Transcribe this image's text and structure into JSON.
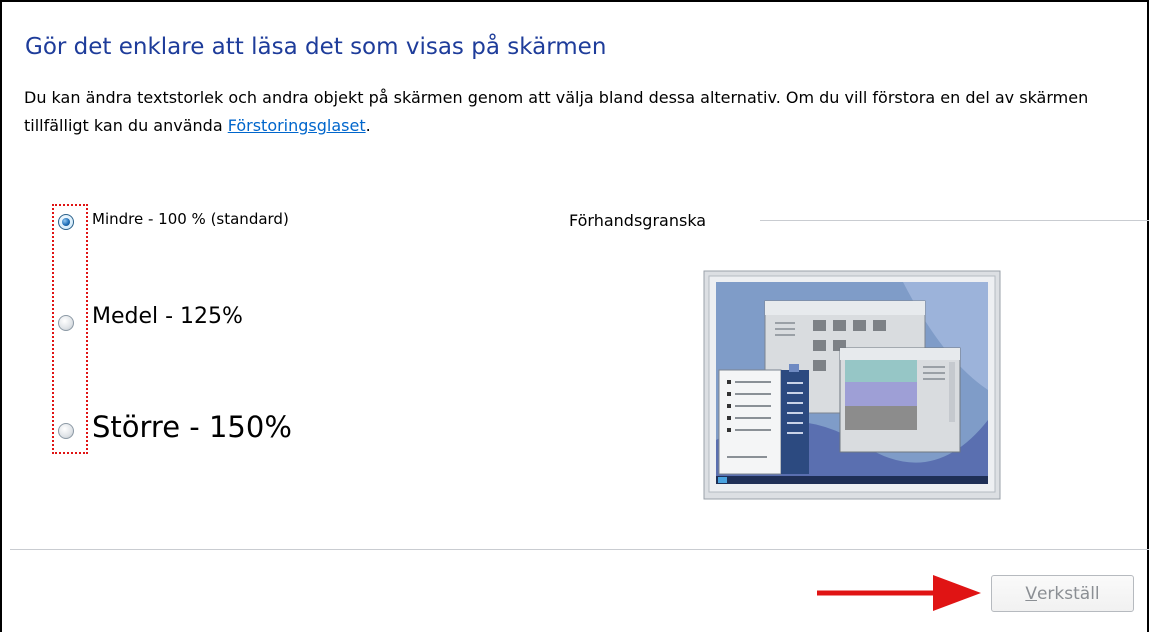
{
  "header": {
    "title": "Gör det enklare att läsa det som visas på skärmen",
    "description_before_link": "Du kan ändra textstorlek och andra objekt på skärmen genom att välja bland dessa alternativ. Om du vill förstora en del av skärmen tillfälligt kan du använda ",
    "link_label": "Förstoringsglaset",
    "description_after_link": "."
  },
  "options": [
    {
      "label": "Mindre - 100 % (standard)",
      "selected": true
    },
    {
      "label": "Medel - 125%",
      "selected": false
    },
    {
      "label": "Större - 150%",
      "selected": false
    }
  ],
  "preview": {
    "label": "Förhandsgranska"
  },
  "footer": {
    "apply_accelerator": "V",
    "apply_rest": "erkställ",
    "apply_enabled": false
  },
  "colors": {
    "title": "#1e3c9a",
    "link": "#0066cc",
    "annotation_red": "#e01414"
  }
}
